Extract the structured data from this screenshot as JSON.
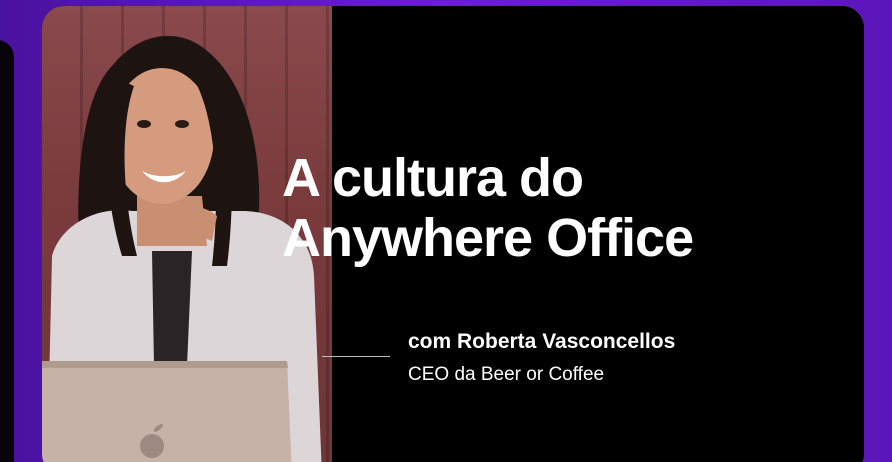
{
  "card": {
    "title_line1": "A cultura do",
    "title_line2": "Anywhere Office",
    "guest_line": "com Roberta Vasconcellos",
    "guest_role": "CEO da Beer or Coffee"
  },
  "colors": {
    "background": "#5a16b8",
    "card": "#000000",
    "text": "#ffffff"
  }
}
